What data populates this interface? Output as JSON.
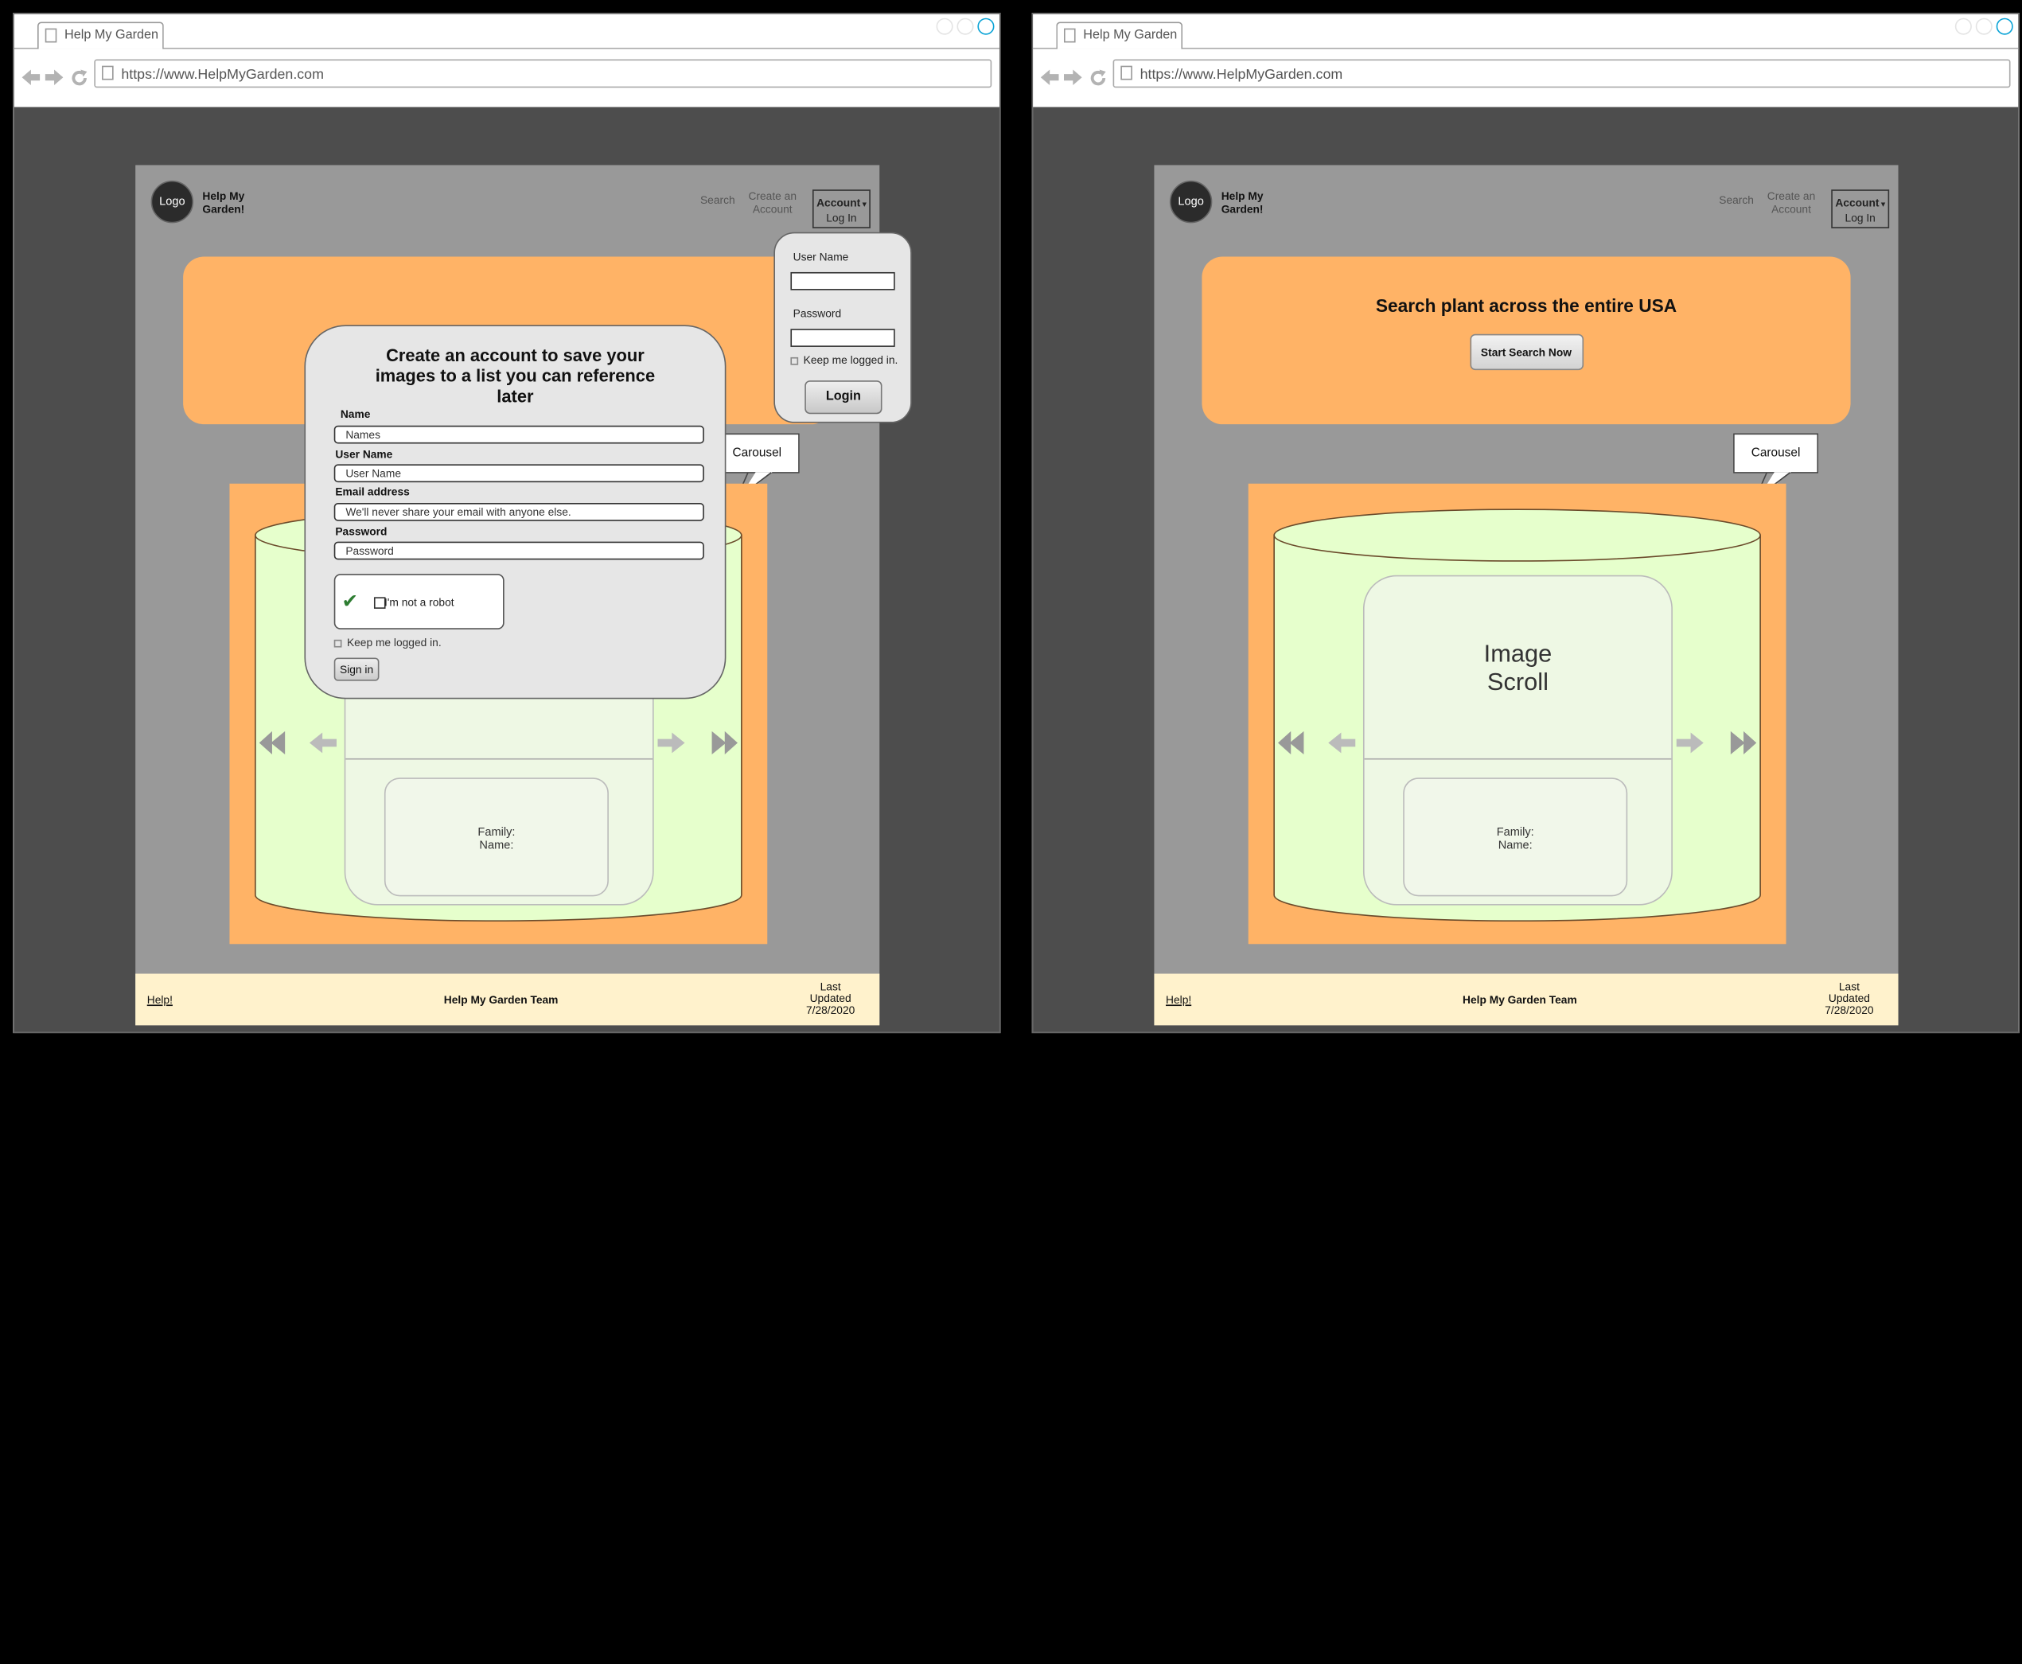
{
  "browser": {
    "tab_title": "Help My Garden",
    "url": "https://www.HelpMyGarden.com"
  },
  "site": {
    "logo_text": "Logo",
    "brand_name": "Help My Garden!",
    "nav": {
      "search": "Search",
      "create_account": "Create an Account",
      "account": "Account",
      "log_in": "Log In"
    },
    "hero": {
      "title": "Search plant across the entire USA",
      "button": "Start Search Now"
    },
    "callout": "Carousel",
    "carousel": {
      "image_label": "Image Scroll",
      "family_label": "Family:",
      "name_label": "Name:"
    },
    "footer": {
      "help": "Help!",
      "team": "Help My Garden Team",
      "last_updated": "Last Updated 7/28/2020"
    }
  },
  "signup_modal": {
    "title": "Create an account to save your images to a list you can reference later",
    "name_label": "Name",
    "name_placeholder": "Names",
    "username_label": "User Name",
    "username_placeholder": "User Name",
    "email_label": "Email address",
    "email_placeholder": "We'll never share your email with anyone else.",
    "password_label": "Password",
    "password_placeholder": "Password",
    "captcha_label": "I'm not a robot",
    "keep_logged_in": "Keep me logged in.",
    "submit": "Sign in"
  },
  "login_popover": {
    "username_label": "User Name",
    "password_label": "Password",
    "keep_logged_in": "Keep me logged in.",
    "submit": "Login"
  },
  "icons": [
    "page-icon",
    "back-arrow-icon",
    "forward-arrow-icon",
    "reload-icon",
    "checkmark-icon",
    "double-left-arrow-icon",
    "left-arrow-icon",
    "right-arrow-icon",
    "double-right-arrow-icon"
  ]
}
